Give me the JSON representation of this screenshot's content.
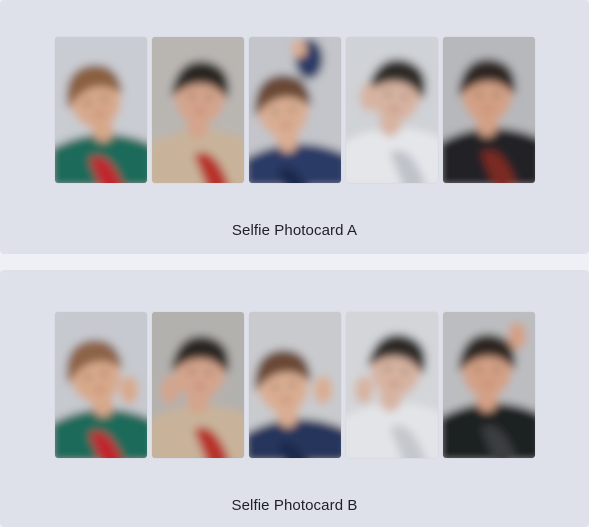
{
  "sections": [
    {
      "caption": "Selfie Photocard A",
      "cards": [
        {
          "icon": "photocard-image",
          "bg": "#c9ccd2",
          "hair": "#8a6040",
          "skin": "#d7a88a",
          "shirt": "#1f6b5a",
          "accent": "#c0282f"
        },
        {
          "icon": "photocard-image",
          "bg": "#b9b6b2",
          "hair": "#2b2522",
          "skin": "#d4a48c",
          "shirt": "#c8b39a",
          "accent": "#b8322c"
        },
        {
          "icon": "photocard-image",
          "bg": "#c3c5ca",
          "hair": "#6b4a34",
          "skin": "#d9ad92",
          "shirt": "#2b3b66",
          "accent": "#1d2a4d"
        },
        {
          "icon": "photocard-image",
          "bg": "#cfd2d6",
          "hair": "#2e2926",
          "skin": "#d7b3a1",
          "shirt": "#e4e6ea",
          "accent": "#bfc3c9"
        },
        {
          "icon": "photocard-image",
          "bg": "#b7b8bb",
          "hair": "#2d2724",
          "skin": "#d3a085",
          "shirt": "#222427",
          "accent": "#7a2a24"
        }
      ]
    },
    {
      "caption": "Selfie Photocard B",
      "cards": [
        {
          "icon": "photocard-image",
          "bg": "#c6c9cf",
          "hair": "#8d6446",
          "skin": "#d8a98b",
          "shirt": "#1f6b5a",
          "accent": "#c0282f"
        },
        {
          "icon": "photocard-image",
          "bg": "#b3b1ae",
          "hair": "#2b2522",
          "skin": "#d4a48c",
          "shirt": "#c8b39a",
          "accent": "#b8322c"
        },
        {
          "icon": "photocard-image",
          "bg": "#c9cacd",
          "hair": "#6b4a34",
          "skin": "#d9ad92",
          "shirt": "#26345c",
          "accent": "#1d2a4d"
        },
        {
          "icon": "photocard-image",
          "bg": "#d3d5d9",
          "hair": "#2e2926",
          "skin": "#d7b3a1",
          "shirt": "#e2e4e8",
          "accent": "#c4c7cc"
        },
        {
          "icon": "photocard-image",
          "bg": "#bcbdc0",
          "hair": "#2d2724",
          "skin": "#d3a085",
          "shirt": "#1f2124",
          "accent": "#3a3c40"
        }
      ]
    }
  ]
}
